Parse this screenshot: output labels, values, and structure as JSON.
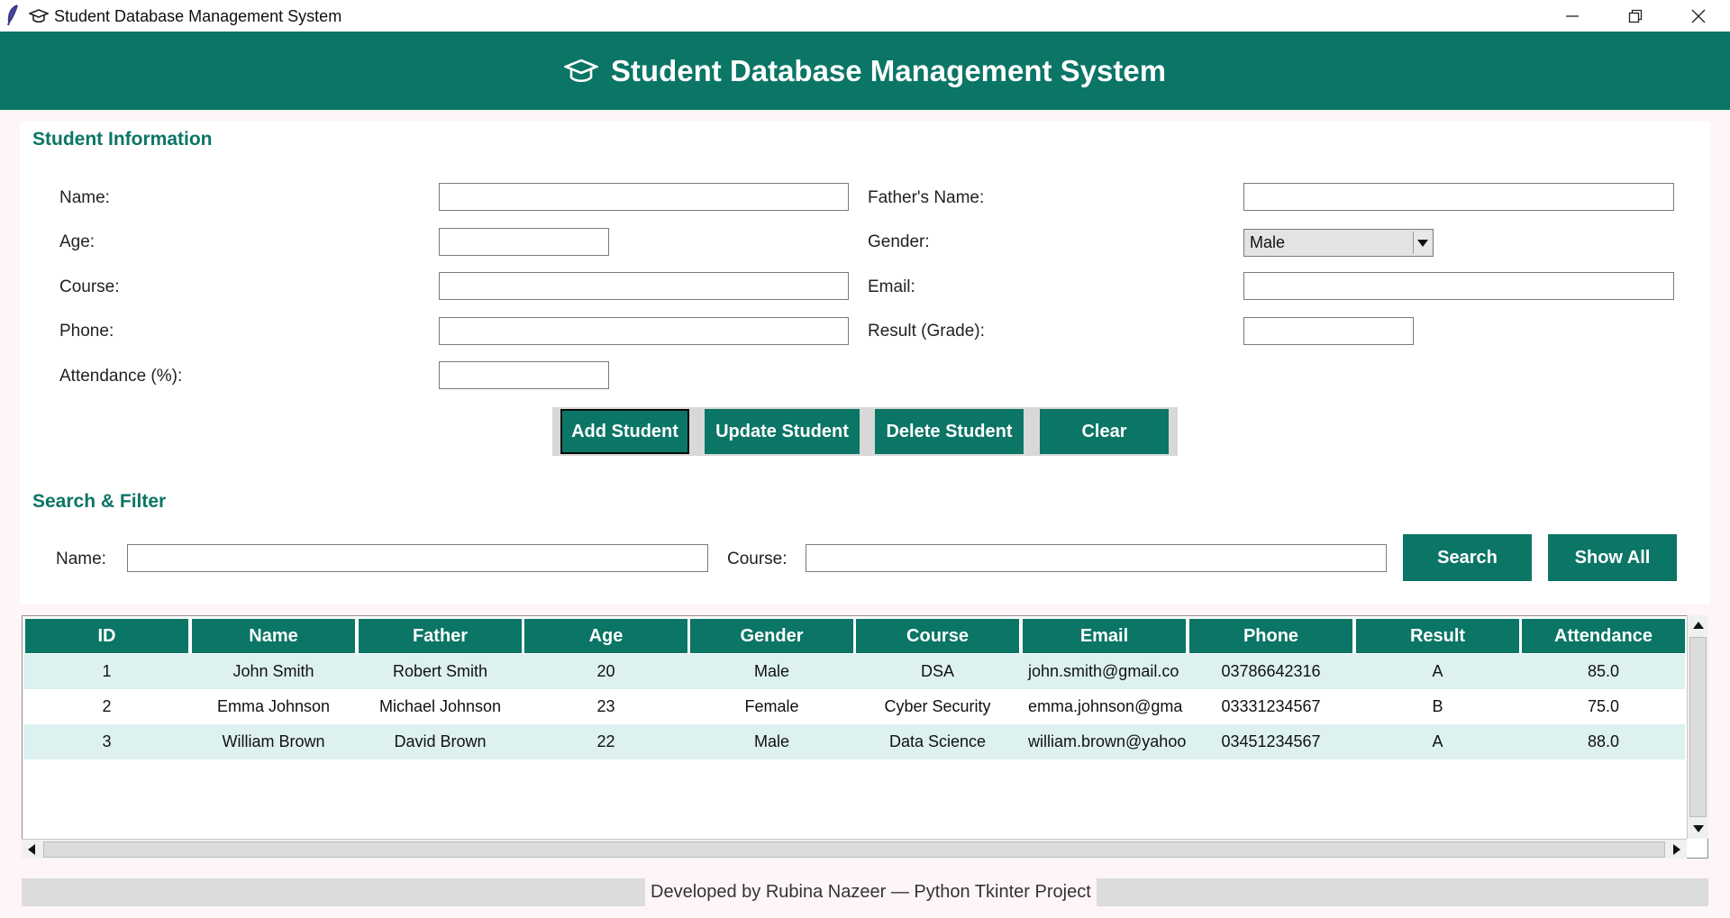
{
  "window": {
    "title": "Student Database Management System",
    "controls": [
      "minimize-icon",
      "restore-icon",
      "close-icon"
    ]
  },
  "header": {
    "title": "Student Database Management System",
    "icon": "graduation-cap-icon"
  },
  "colors": {
    "primary": "#0b7566",
    "background": "#fef5f7",
    "row_alt": "#ddf1f1",
    "button_text": "#ffffff"
  },
  "form": {
    "section_title": "Student Information",
    "name_label": "Name:",
    "name_value": "",
    "father_label": "Father's Name:",
    "father_value": "",
    "age_label": "Age:",
    "age_value": "",
    "gender_label": "Gender:",
    "gender_value": "Male",
    "course_label": "Course:",
    "course_value": "",
    "email_label": "Email:",
    "email_value": "",
    "phone_label": "Phone:",
    "phone_value": "",
    "result_label": "Result (Grade):",
    "result_value": "",
    "attendance_label": "Attendance (%):",
    "attendance_value": ""
  },
  "actions": {
    "add": "Add Student",
    "update": "Update Student",
    "delete": "Delete Student",
    "clear": "Clear"
  },
  "search": {
    "section_title": "Search & Filter",
    "name_label": "Name:",
    "name_value": "",
    "course_label": "Course:",
    "course_value": "",
    "search_button": "Search",
    "show_all_button": "Show All"
  },
  "table": {
    "columns": [
      "ID",
      "Name",
      "Father",
      "Age",
      "Gender",
      "Course",
      "Email",
      "Phone",
      "Result",
      "Attendance"
    ],
    "rows": [
      [
        "1",
        "John Smith",
        "Robert Smith",
        "20",
        "Male",
        "DSA",
        "john.smith@gmail.co",
        "03786642316",
        "A",
        "85.0"
      ],
      [
        "2",
        "Emma Johnson",
        "Michael Johnson",
        "23",
        "Female",
        "Cyber Security",
        "emma.johnson@gma",
        "03331234567",
        "B",
        "75.0"
      ],
      [
        "3",
        "William Brown",
        "David Brown",
        "22",
        "Male",
        "Data Science",
        "william.brown@yahoo",
        "03451234567",
        "A",
        "88.0"
      ]
    ]
  },
  "footer": {
    "text": "Developed by Rubina Nazeer — Python Tkinter Project"
  }
}
